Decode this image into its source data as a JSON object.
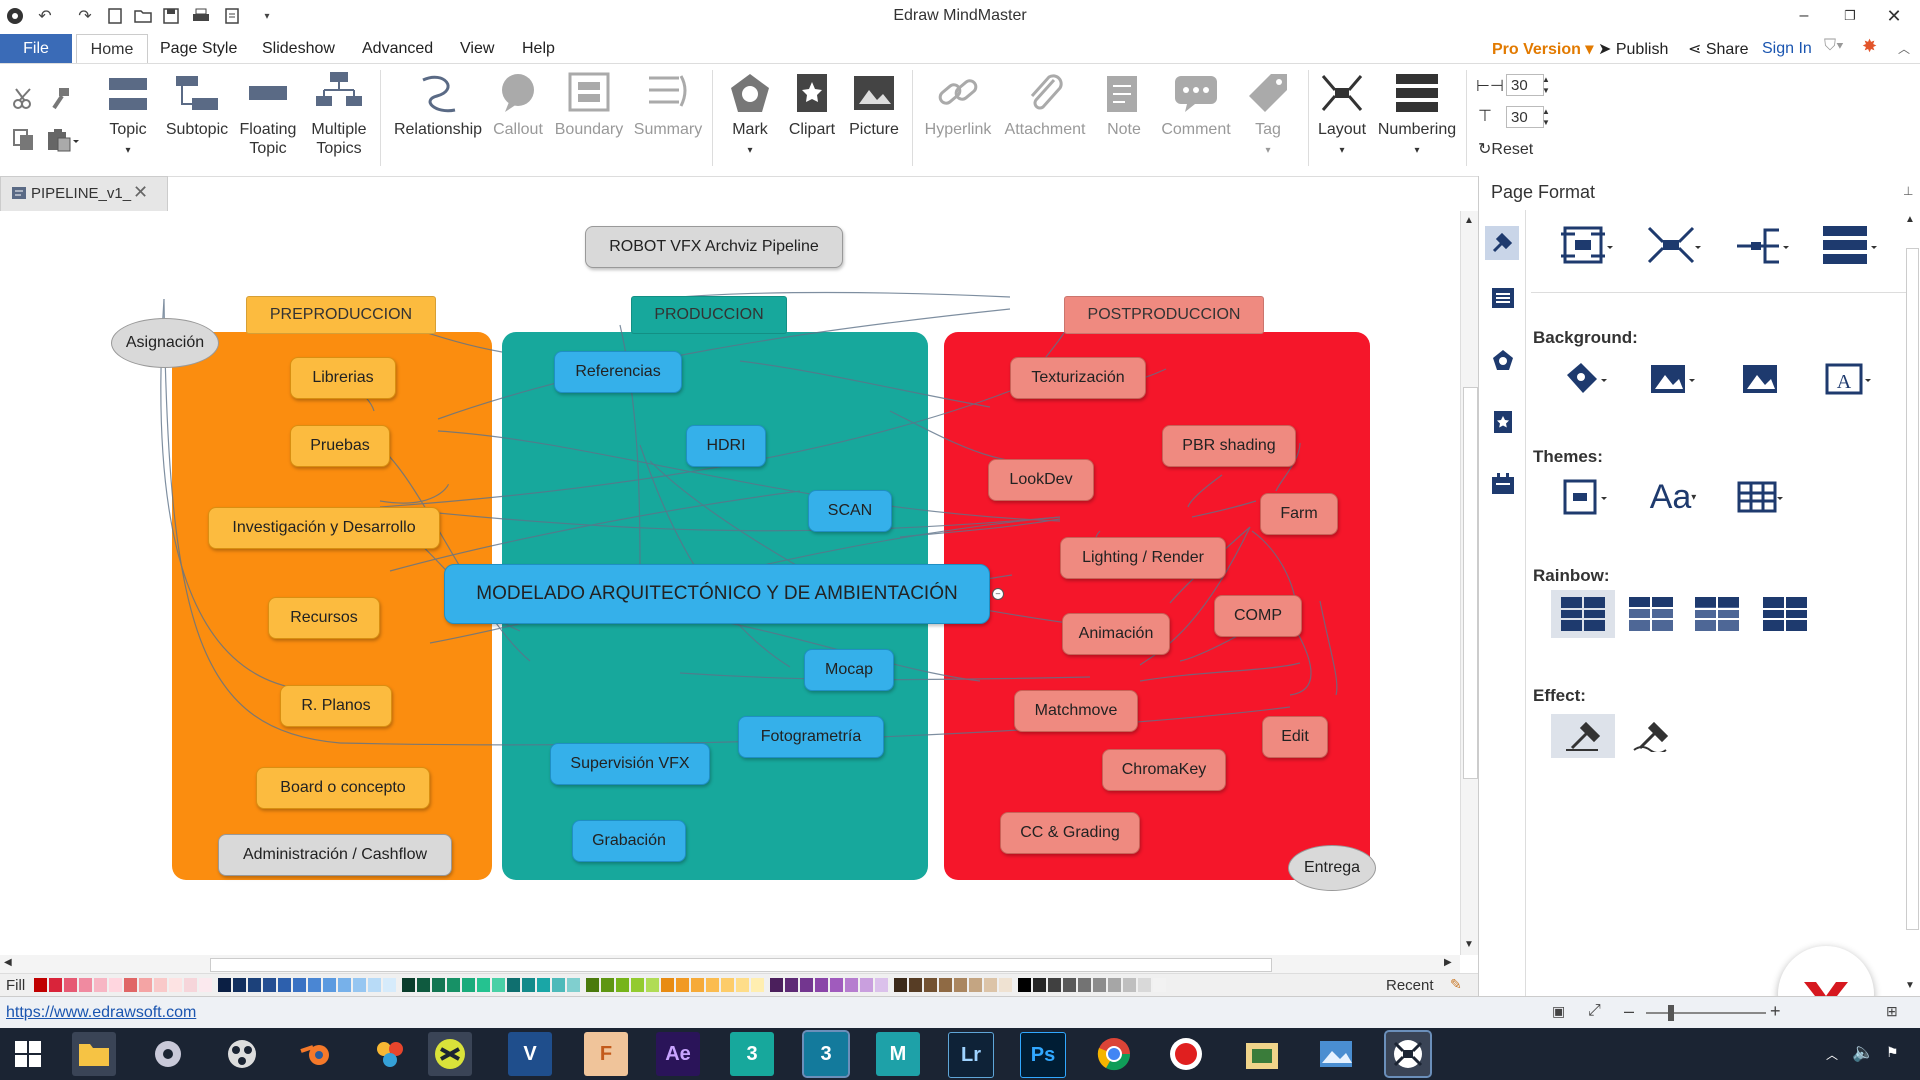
{
  "window": {
    "title": "Edraw MindMaster"
  },
  "menu": {
    "file": "File",
    "tabs": [
      "Home",
      "Page Style",
      "Slideshow",
      "Advanced",
      "View",
      "Help"
    ],
    "pro_version": "Pro Version",
    "publish": "Publish",
    "share": "Share",
    "sign_in": "Sign In"
  },
  "ribbon": {
    "topic": "Topic",
    "subtopic": "Subtopic",
    "floating_topic_1": "Floating",
    "floating_topic_2": "Topic",
    "multiple_topics_1": "Multiple",
    "multiple_topics_2": "Topics",
    "relationship": "Relationship",
    "callout": "Callout",
    "boundary": "Boundary",
    "summary": "Summary",
    "mark": "Mark",
    "clipart": "Clipart",
    "picture": "Picture",
    "hyperlink": "Hyperlink",
    "attachment": "Attachment",
    "note": "Note",
    "comment": "Comment",
    "tag": "Tag",
    "layout": "Layout",
    "numbering": "Numbering",
    "spacing_h": "30",
    "spacing_v": "30",
    "reset": "Reset"
  },
  "document": {
    "tab_name": "PIPELINE_v1_"
  },
  "mindmap": {
    "title": "ROBOT VFX Archviz Pipeline",
    "central": "MODELADO ARQUITECTÓNICO Y DE AMBIENTACIÓN",
    "asignacion": "Asignación",
    "entrega": "Entrega",
    "pre": {
      "header": "PREPRODUCCION",
      "items": [
        "Librerias",
        "Pruebas",
        "Investigación y Desarrollo",
        "Recursos",
        "R. Planos",
        "Board o concepto"
      ]
    },
    "admin": "Administración / Cashflow",
    "prod": {
      "header": "PRODUCCION",
      "items": [
        "Referencias",
        "HDRI",
        "SCAN",
        "Mocap",
        "Fotogrametría",
        "Supervisión VFX",
        "Grabación"
      ]
    },
    "post": {
      "header": "POSTPRODUCCION",
      "items": [
        "Texturización",
        "PBR shading",
        "LookDev",
        "Farm",
        "Lighting / Render",
        "COMP",
        "Animación",
        "Matchmove",
        "Edit",
        "ChromaKey",
        "CC & Grading"
      ]
    },
    "colors": {
      "pre": "#fb8d0f",
      "prod": "#17a89c",
      "post": "#f5162a"
    }
  },
  "palette": {
    "fill_label": "Fill",
    "recent_label": "Recent"
  },
  "side_panel": {
    "title": "Page Format",
    "background": "Background:",
    "themes": "Themes:",
    "theme_font": "Aa",
    "rainbow": "Rainbow:",
    "effect": "Effect:"
  },
  "status": {
    "url": "https://www.edrawsoft.com"
  },
  "taskbar": {
    "apps": [
      "V",
      "Ae",
      "3",
      "3",
      "M",
      "Lr",
      "Ps"
    ]
  }
}
